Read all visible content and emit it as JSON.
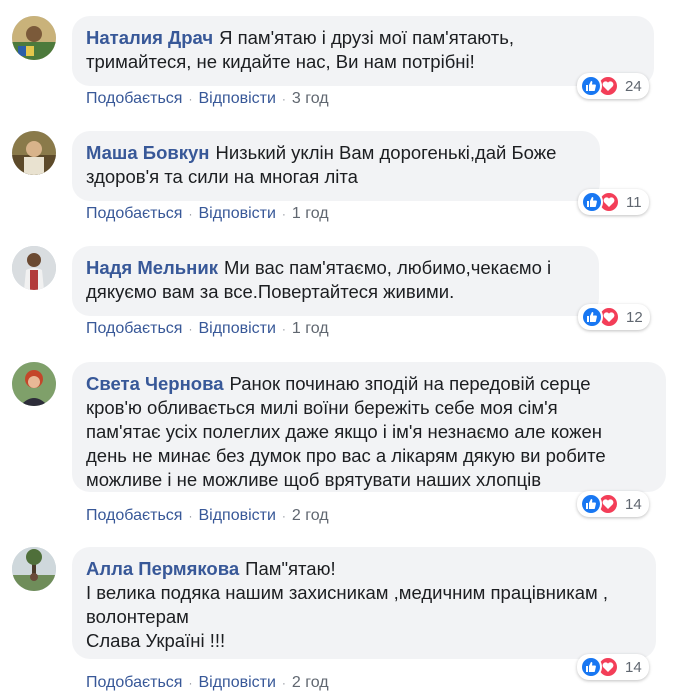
{
  "comments": [
    {
      "author": "Наталия Драч",
      "text": "Я пам'ятаю і друзі мої пам'ятають,\nтримайтеся, не кидайте нас, Ви нам потрібні!",
      "reaction_count": "24",
      "like_label": "Подобається",
      "reply_label": "Відповісти",
      "time": "3 год"
    },
    {
      "author": "Маша Бовкун",
      "text": "Низький уклін Вам дорогенькі,дай Боже\nздоров'я та сили на многая літа",
      "reaction_count": "11",
      "like_label": "Подобається",
      "reply_label": "Відповісти",
      "time": "1 год"
    },
    {
      "author": "Надя Мельник",
      "text": "Ми вас пам'ятаємо, любимо,чекаємо і\nдякуємо вам за все.Повертайтеся живими.",
      "reaction_count": "12",
      "like_label": "Подобається",
      "reply_label": "Відповісти",
      "time": "1 год"
    },
    {
      "author": "Света Чернова",
      "text": "Ранок починаю зподій на передовій серце\nкров'ю обливається милі воїни бережіть себе моя сім'я\nпам'ятає усіх полеглих даже якщо і ім'я незнаємо але кожен\nдень не минає без думок про вас а лікарям дякую ви робите\nможливе і не можливе щоб врятувати наших хлопців",
      "reaction_count": "14",
      "like_label": "Подобається",
      "reply_label": "Відповісти",
      "time": "2 год"
    },
    {
      "author": "Алла Пермякова",
      "text": "Пам\"ятаю!\nІ велика подяка нашим захисникам ,медичним працівникам ,\nволонтерам\nСлава Україні !!!",
      "reaction_count": "14",
      "like_label": "Подобається",
      "reply_label": "Відповісти",
      "time": "2 год"
    }
  ],
  "colors": {
    "author": "#385898",
    "bubble": "#f2f3f5",
    "like_reaction": "#1877f2",
    "love_reaction": "#f33e58",
    "meta_text": "#606770"
  },
  "icons": [
    "like-reaction-icon",
    "love-reaction-icon",
    "user-avatar"
  ]
}
